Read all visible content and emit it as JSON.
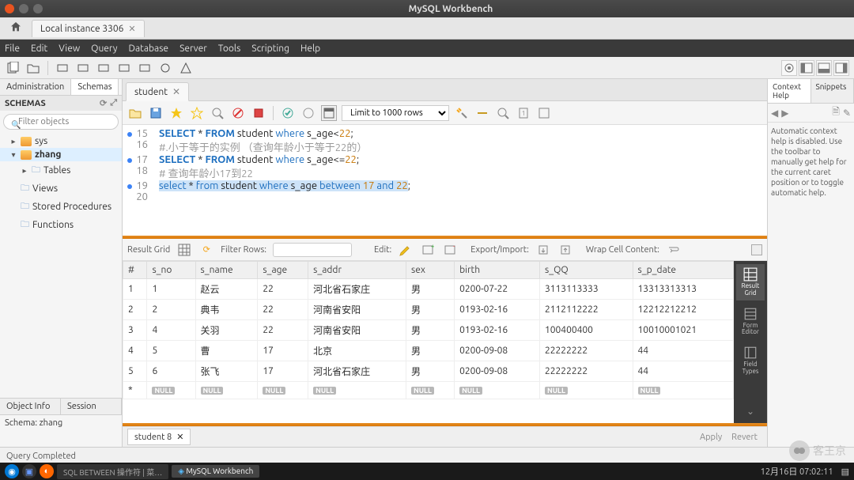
{
  "titlebar": {
    "title": "MySQL Workbench"
  },
  "conntabs": {
    "label": "Local instance 3306"
  },
  "menubar": [
    "File",
    "Edit",
    "View",
    "Query",
    "Database",
    "Server",
    "Tools",
    "Scripting",
    "Help"
  ],
  "leftpanel": {
    "tabs": [
      "Administration",
      "Schemas"
    ],
    "header": "SCHEMAS",
    "filter_placeholder": "Filter objects",
    "tree": {
      "sys": "sys",
      "zhang": "zhang",
      "tables": "Tables",
      "views": "Views",
      "sp": "Stored Procedures",
      "fn": "Functions"
    },
    "bottom_tabs": [
      "Object Info",
      "Session"
    ],
    "schema_info": "Schema: zhang"
  },
  "editor": {
    "tab": "student",
    "limit_label": "Limit to 1000 rows",
    "lines": [
      {
        "n": "15",
        "dot": true,
        "html": "<span class='kw'>SELECT</span> * <span class='kw'>FROM</span> <span class='ident'>student</span> <span class='kw2'>where</span> <span class='ident'>s_age</span>&lt;<span class='num'>22</span>;"
      },
      {
        "n": "16",
        "dot": false,
        "html": "<span class='cmt'>#.小于等于的实例 （查询年龄小于等于22的）</span>"
      },
      {
        "n": "17",
        "dot": true,
        "html": "<span class='kw'>SELECT</span> * <span class='kw'>FROM</span> <span class='ident'>student</span> <span class='kw2'>where</span> <span class='ident'>s_age</span>&lt;=<span class='num'>22</span>;"
      },
      {
        "n": "18",
        "dot": false,
        "html": "<span class='cmt'># 查询年龄小17到22</span>"
      },
      {
        "n": "19",
        "dot": true,
        "html": "<span class='sel-bg'><span class='kw2'>select</span> * <span class='kw2'>from</span> <span class='ident'>student</span> <span class='kw2'>where</span> <span class='ident'>s_age</span> <span class='kw2'>between</span> <span class='num'>17</span> <span class='kw2'>and</span> <span class='num'>22</span></span>;"
      },
      {
        "n": "20",
        "dot": false,
        "html": ""
      }
    ]
  },
  "resultbar": {
    "result_grid": "Result Grid",
    "filter_rows": "Filter Rows:",
    "edit": "Edit:",
    "export_import": "Export/Import:",
    "wrap": "Wrap Cell Content:"
  },
  "grid": {
    "columns": [
      "#",
      "s_no",
      "s_name",
      "s_age",
      "s_addr",
      "sex",
      "birth",
      "s_QQ",
      "s_p_date"
    ],
    "rows": [
      [
        "1",
        "1",
        "赵云",
        "22",
        "河北省石家庄",
        "男",
        "0200-07-22",
        "3113113333",
        "13313313313"
      ],
      [
        "2",
        "2",
        "典韦",
        "22",
        "河南省安阳",
        "男",
        "0193-02-16",
        "2112112222",
        "12212212212"
      ],
      [
        "3",
        "4",
        "关羽",
        "22",
        "河南省安阳",
        "男",
        "0193-02-16",
        "100400400",
        "10010001021"
      ],
      [
        "4",
        "5",
        "曹",
        "17",
        "北京",
        "男",
        "0200-09-08",
        "22222222",
        "44"
      ],
      [
        "5",
        "6",
        "张飞",
        "17",
        "河北省石家庄",
        "男",
        "0200-09-08",
        "22222222",
        "44"
      ]
    ]
  },
  "result_sidebar": {
    "items": [
      "Result Grid",
      "Form Editor",
      "Field Types"
    ]
  },
  "result_tabs": {
    "tab": "student 8",
    "apply": "Apply",
    "revert": "Revert"
  },
  "rightpanel": {
    "tabs": [
      "Context Help",
      "Snippets"
    ],
    "help_text": "Automatic context help is disabled. Use the toolbar to manually get help for the current caret position or to toggle automatic help."
  },
  "statusbar": {
    "text": "Query Completed"
  },
  "taskbar": {
    "items": [
      "SQL BETWEEN 操作符 | 菜…",
      "MySQL Workbench"
    ],
    "clock": "12月16日 07:02:11"
  },
  "watermark": "客王京"
}
